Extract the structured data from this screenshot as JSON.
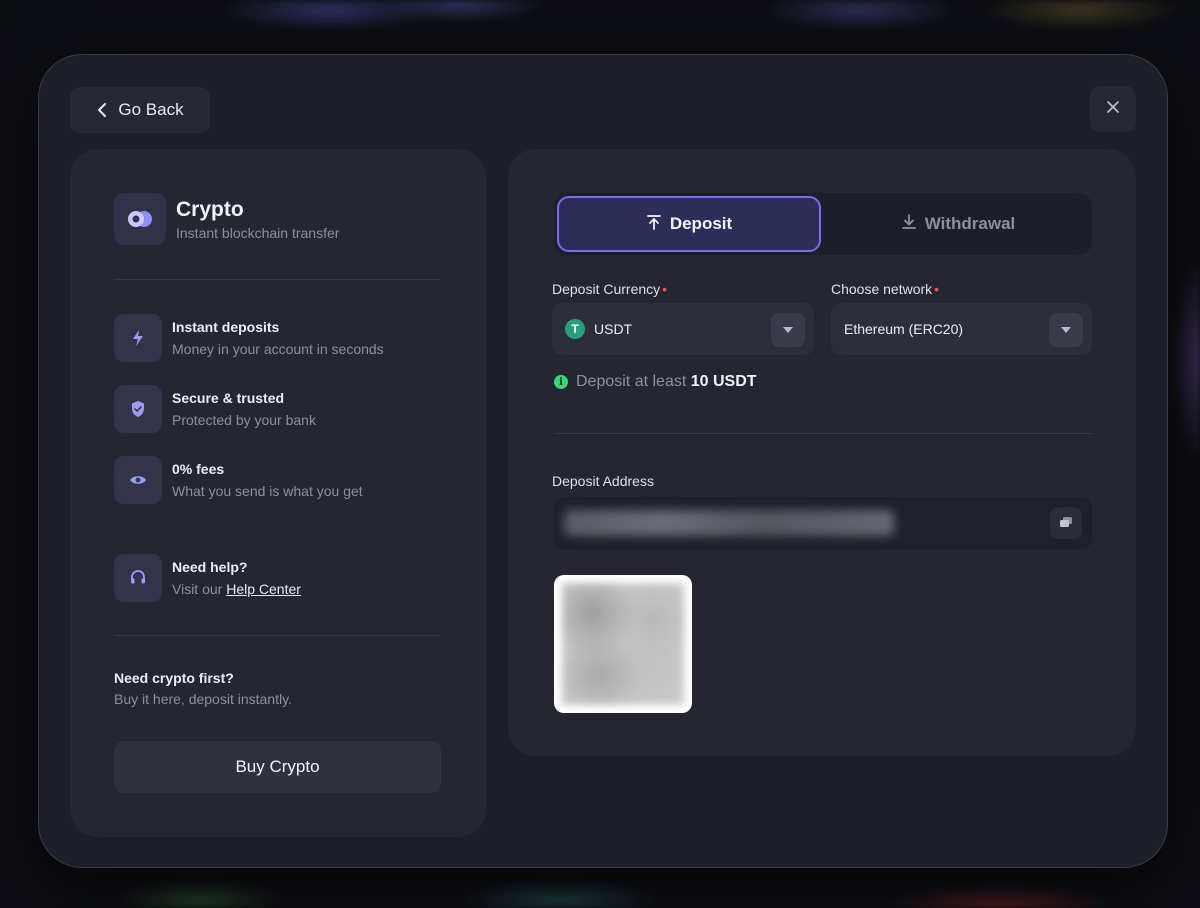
{
  "header": {
    "back_label": "Go Back"
  },
  "method": {
    "title": "Crypto",
    "subtitle": "Instant blockchain transfer"
  },
  "features": [
    {
      "title": "Instant deposits",
      "subtitle": "Money in your account in seconds",
      "icon": "lightning-icon"
    },
    {
      "title": "Secure & trusted",
      "subtitle": "Protected by your bank",
      "icon": "shield-icon"
    },
    {
      "title": "0% fees",
      "subtitle": "What you send is what you get",
      "icon": "eye-icon"
    }
  ],
  "help": {
    "title": "Need help?",
    "prefix": "Visit our ",
    "link": "Help Center",
    "icon": "headset-icon"
  },
  "buy": {
    "title": "Need crypto first?",
    "subtitle": "Buy it here, deposit instantly.",
    "button": "Buy Crypto"
  },
  "tabs": [
    {
      "label": "Deposit",
      "active": true,
      "icon": "upload-arrow-icon"
    },
    {
      "label": "Withdrawal",
      "active": false,
      "icon": "download-icon"
    }
  ],
  "form": {
    "currency_label": "Deposit Currency",
    "currency_value": "USDT",
    "currency_icon": "T",
    "network_label": "Choose network",
    "network_value": "Ethereum (ERC20)",
    "required_mark": "•",
    "min_prefix": "Deposit at least ",
    "min_amount": "10 USDT",
    "address_label": "Deposit Address"
  },
  "colors": {
    "accent": "#6e6ff2",
    "info": "#3dd37a",
    "required": "#f05555",
    "tether": "#26a17b"
  }
}
